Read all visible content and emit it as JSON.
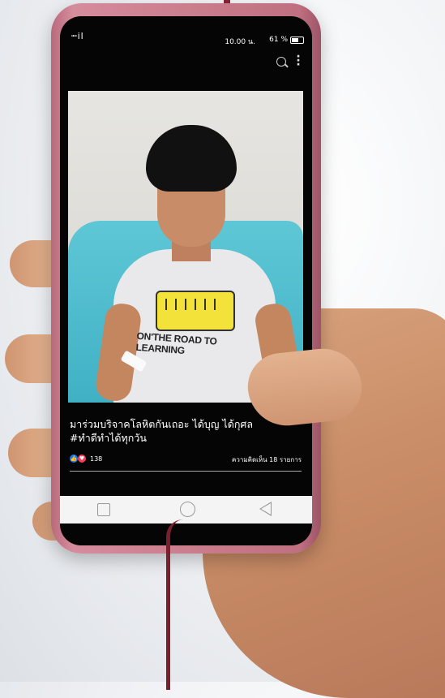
{
  "status_bar": {
    "signal": "┉il",
    "time": "10.00 น.",
    "battery": "61 %"
  },
  "post": {
    "caption_line1": "มาร่วมบริจาคโลหิตกันเถอะ ได้บุญ ได้กุศล",
    "caption_line2": "#ทำดีทำได้ทุกวัน",
    "reaction_count": "138",
    "comments": "ความคิดเห็น 18 รายการ",
    "shirt_text": "ON'THE ROAD TO LEARNING"
  },
  "icons": {
    "like": "👍",
    "heart": "♥"
  },
  "colors": {
    "like": "#1877f2",
    "heart": "#f33e58",
    "phone_case": "#c98090"
  }
}
